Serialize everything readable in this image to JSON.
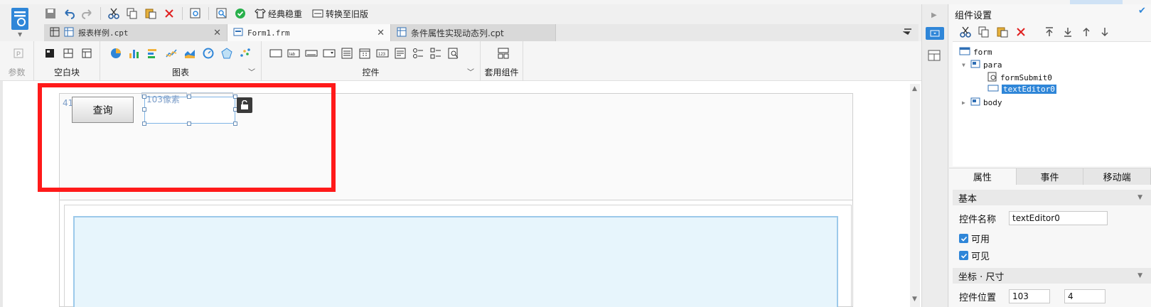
{
  "quick_toolbar": {
    "classic_label": "经典稳重",
    "convert_label": "转换至旧版"
  },
  "tabs": [
    {
      "label": "报表样例.cpt",
      "active": false
    },
    {
      "label": "Form1.frm",
      "active": true
    },
    {
      "label": "条件属性实现动态列.cpt",
      "active": false
    }
  ],
  "ribbon": {
    "param_label": "参数",
    "blank_label": "空白块",
    "chart_label": "图表",
    "control_label": "控件",
    "suite_label": "套用组件"
  },
  "canvas": {
    "px41": "41像素",
    "px103": "103像素",
    "query_button": "查询"
  },
  "panel": {
    "title": "组件设置",
    "tree": [
      {
        "label": "form",
        "selected": false
      },
      {
        "label": "para",
        "selected": false
      },
      {
        "label": "formSubmit0",
        "selected": false
      },
      {
        "label": "textEditor0",
        "selected": true
      },
      {
        "label": "body",
        "selected": false
      }
    ],
    "tabs": [
      "属性",
      "事件",
      "移动端"
    ],
    "section_basic": "基本",
    "name_label": "控件名称",
    "name_value": "textEditor0",
    "enabled_label": "可用",
    "visible_label": "可见",
    "section_pos": "坐标 · 尺寸",
    "pos_label": "控件位置",
    "pos_x": "103",
    "pos_y": "4"
  },
  "colors": {
    "accent": "#2f86d8",
    "highlight_box": "#ff1a1a",
    "body_fill": "#e7f5fc"
  }
}
